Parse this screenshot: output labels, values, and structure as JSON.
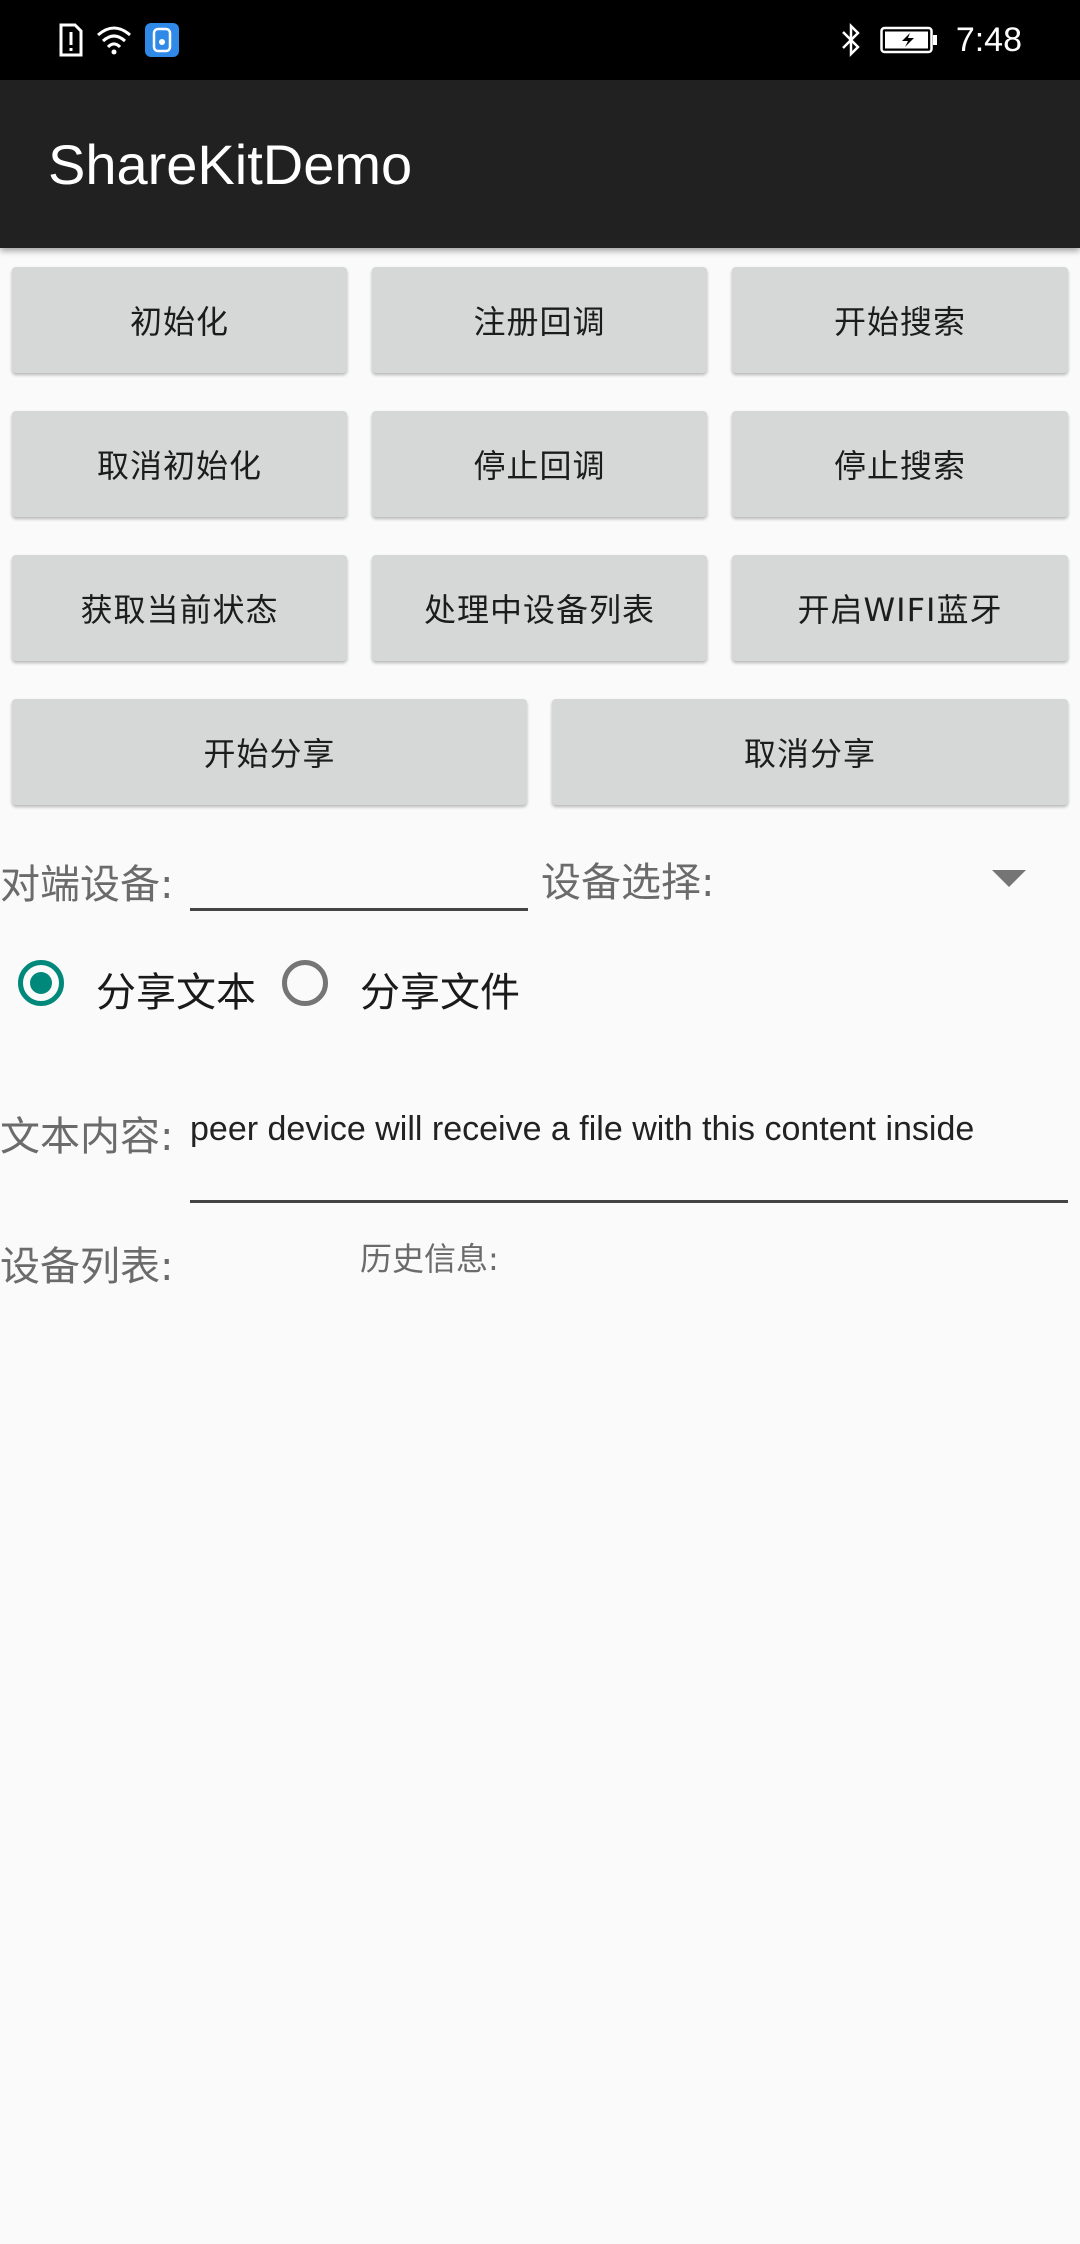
{
  "status_bar": {
    "time": "7:48",
    "icons": [
      "sim-alert-icon",
      "wifi-icon",
      "app-notification-icon",
      "bluetooth-icon",
      "battery-charging-icon"
    ]
  },
  "app_bar": {
    "title": "ShareKitDemo"
  },
  "buttons": {
    "row1": [
      "初始化",
      "注册回调",
      "开始搜索"
    ],
    "row2": [
      "取消初始化",
      "停止回调",
      "停止搜索"
    ],
    "row3": [
      "获取当前状态",
      "处理中设备列表",
      "开启WIFI蓝牙"
    ],
    "row4": [
      "开始分享",
      "取消分享"
    ]
  },
  "peer_device": {
    "label": "对端设备:",
    "value": ""
  },
  "device_select": {
    "label": "设备选择:",
    "icon": "dropdown-arrow-icon"
  },
  "share_type": {
    "options": [
      "分享文本",
      "分享文件"
    ],
    "selected": "分享文本"
  },
  "text_content": {
    "label": "文本内容:",
    "value": "peer device will receive a file with this content inside"
  },
  "device_list": {
    "label": "设备列表:"
  },
  "history": {
    "label": "历史信息:"
  },
  "colors": {
    "accent": "#00897b",
    "appbar": "#212121",
    "button": "#d6d7d7"
  }
}
